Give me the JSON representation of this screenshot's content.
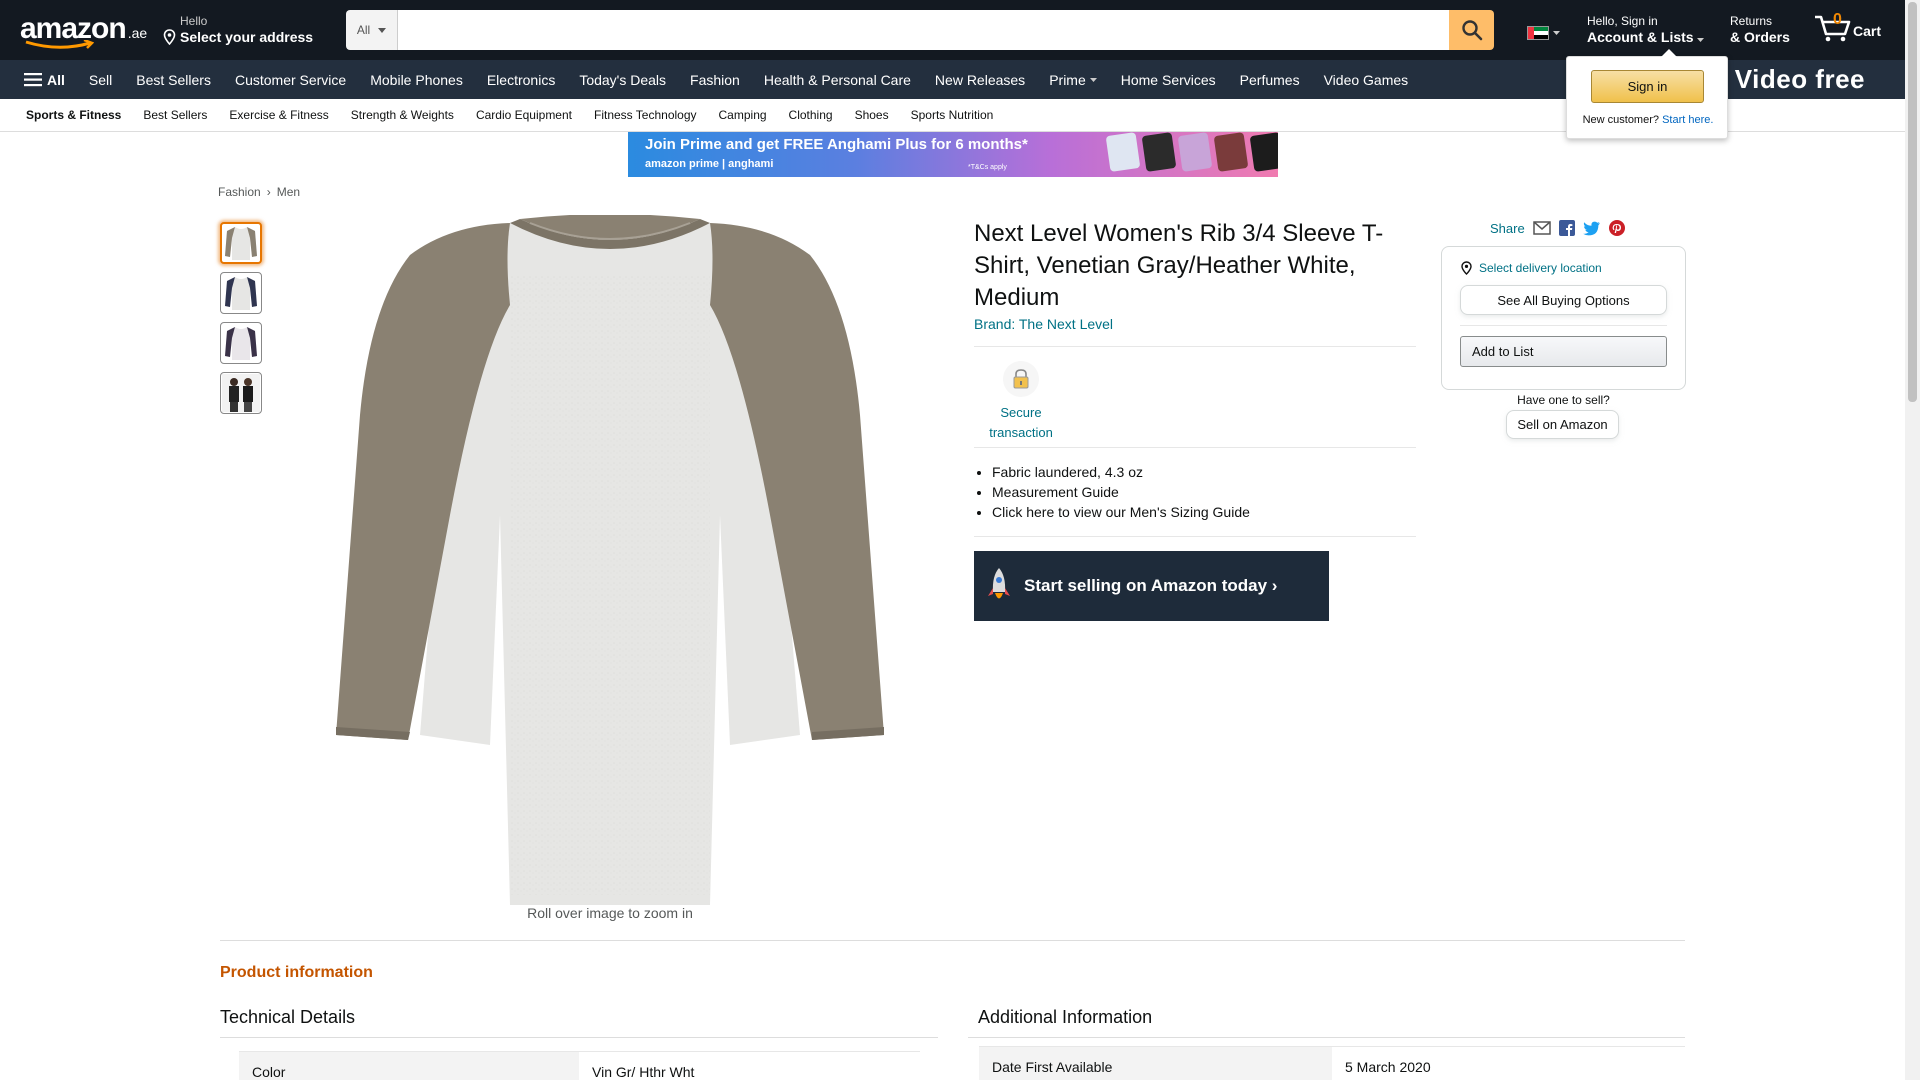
{
  "nav": {
    "logo": "amazon",
    "logo_tld": ".ae",
    "deliver_hello": "Hello",
    "deliver_address": "Select your address",
    "search_category": "All",
    "search_placeholder": "",
    "account_l1": "Hello, Sign in",
    "account_l2": "Account & Lists",
    "returns_l1": "Returns",
    "returns_l2": "& Orders",
    "cart_count": "0",
    "cart_label": "Cart"
  },
  "main_nav": {
    "all_label": "All",
    "items": [
      "Sell",
      "Best Sellers",
      "Customer Service",
      "Mobile Phones",
      "Electronics",
      "Today's Deals",
      "Fashion",
      "Health & Personal Care",
      "New Releases",
      "Prime",
      "Home Services",
      "Perfumes",
      "Video Games"
    ],
    "prime_video": "me Video free"
  },
  "category_bar": {
    "items": [
      "Sports & Fitness",
      "Best Sellers",
      "Exercise & Fitness",
      "Strength & Weights",
      "Cardio Equipment",
      "Fitness Technology",
      "Camping",
      "Clothing",
      "Shoes",
      "Sports Nutrition"
    ]
  },
  "banner": {
    "headline": "Join Prime and get FREE Anghami Plus for 6 months*",
    "brands": "amazon prime  |  anghami",
    "terms": "*T&Cs apply"
  },
  "breadcrumb": [
    "Fashion",
    "Men"
  ],
  "product": {
    "title": "Next Level Women's Rib 3/4 Sleeve T-Shirt, Venetian Gray/Heather White, Medium",
    "brand": "Brand: The Next Level",
    "secure_label_1": "Secure",
    "secure_label_2": "transaction",
    "bullets": [
      "Fabric laundered, 4.3 oz",
      "Measurement Guide",
      "Click here to view our Men's Sizing Guide"
    ],
    "sell_banner": "Start selling on Amazon today ›",
    "zoom_hint": "Roll over image to zoom in"
  },
  "buybox": {
    "share": "Share",
    "delivery_location": "Select delivery location",
    "see_all": "See All Buying Options",
    "add_to_list": "Add to List",
    "have_one": "Have one to sell?",
    "sell_on_amazon": "Sell on Amazon"
  },
  "flyout": {
    "sign_in": "Sign in",
    "new_customer": "New customer?",
    "start_here": "Start here."
  },
  "details": {
    "product_information": "Product information",
    "technical_details": "Technical Details",
    "additional_information": "Additional Information",
    "tech_rows": [
      {
        "key": "Color",
        "value": "Vin Gr/ Hthr Wht"
      }
    ],
    "addl_rows": [
      {
        "key": "Date First Available",
        "value": "5 March 2020"
      }
    ]
  },
  "colors": {
    "nav_dark": "#131921",
    "nav_sub": "#232F3E",
    "search_button": "#FEBD69",
    "link": "#007185",
    "accent_orange": "#C45500",
    "sleeve_gray": "#8a8172",
    "body_heather": "#e6e6e4"
  }
}
